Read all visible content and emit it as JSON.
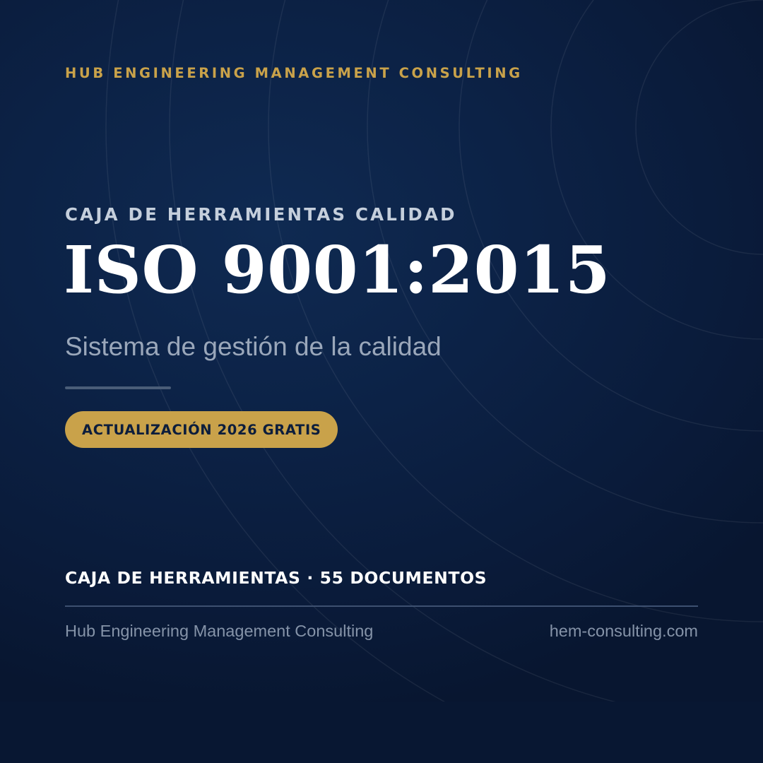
{
  "colors": {
    "background": "#0c2246",
    "accent_gold": "#c9a24a",
    "title": "#ffffff",
    "muted_text": "#9aa7ba"
  },
  "brand_top": "HUB ENGINEERING MANAGEMENT CONSULTING",
  "kicker": "CAJA DE HERRAMIENTAS CALIDAD",
  "title": "ISO 9001:2015",
  "subtitle": "Sistema de gestión de la calidad",
  "badge": "ACTUALIZACIÓN 2026 GRATIS",
  "docs_line": "CAJA DE HERRAMIENTAS · 55 DOCUMENTOS",
  "footer": {
    "company": "Hub Engineering Management Consulting",
    "website": "hem-consulting.com"
  }
}
